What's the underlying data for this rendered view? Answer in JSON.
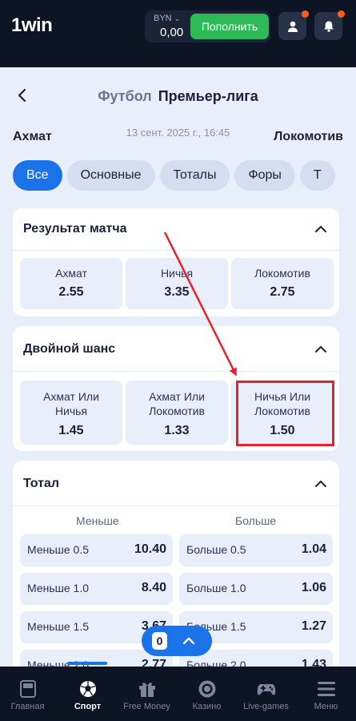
{
  "header": {
    "logo": "1win",
    "currency": "BYN",
    "balance": "0,00",
    "deposit_label": "Пополнить",
    "icons": [
      "user-icon",
      "bell-icon"
    ]
  },
  "match": {
    "sport": "Футбол",
    "league": "Премьер-лига",
    "home": "Ахмат",
    "away": "Локомотив",
    "datetime": "13 сент. 2025 г., 16:45"
  },
  "tabs": [
    {
      "label": "Все",
      "active": true
    },
    {
      "label": "Основные"
    },
    {
      "label": "Тоталы"
    },
    {
      "label": "Форы"
    },
    {
      "label": "Т"
    }
  ],
  "markets": {
    "result": {
      "title": "Результат матча",
      "odds": [
        {
          "label": "Ахмат",
          "value": "2.55"
        },
        {
          "label": "Ничья",
          "value": "3.35"
        },
        {
          "label": "Локомотив",
          "value": "2.75"
        }
      ]
    },
    "double_chance": {
      "title": "Двойной шанс",
      "odds": [
        {
          "label1": "Ахмат Или",
          "label2": "Ничья",
          "value": "1.45"
        },
        {
          "label1": "Ахмат Или",
          "label2": "Локомотив",
          "value": "1.33"
        },
        {
          "label1": "Ничья Или",
          "label2": "Локомотив",
          "value": "1.50"
        }
      ]
    },
    "total": {
      "title": "Тотал",
      "under_header": "Меньше",
      "over_header": "Больше",
      "rows": [
        {
          "under_label": "Меньше 0.5",
          "under_value": "10.40",
          "over_label": "Больше 0.5",
          "over_value": "1.04"
        },
        {
          "under_label": "Меньше 1.0",
          "under_value": "8.40",
          "over_label": "Больше 1.0",
          "over_value": "1.06"
        },
        {
          "under_label": "Меньше 1.5",
          "under_value": "3.67",
          "over_label": "Больше 1.5",
          "over_value": "1.27"
        },
        {
          "under_label": "Меньше 2.0",
          "under_value": "2.77",
          "over_label": "Больше 2.0",
          "over_value": "1.43"
        }
      ]
    }
  },
  "coupon": {
    "count": "0"
  },
  "bottom_nav": [
    {
      "label": "Главная",
      "icon": "home-icon"
    },
    {
      "label": "Спорт",
      "icon": "soccer-ball-icon",
      "active": true
    },
    {
      "label": "Free Money",
      "icon": "gift-icon"
    },
    {
      "label": "Казино",
      "icon": "casino-chip-icon"
    },
    {
      "label": "Live-games",
      "icon": "gamepad-icon"
    },
    {
      "label": "Меню",
      "icon": "menu-icon"
    }
  ],
  "colors": {
    "accent": "#1a73e8",
    "deposit": "#2fba5a",
    "highlight": "#e8202b",
    "topbar": "#0d1424"
  }
}
